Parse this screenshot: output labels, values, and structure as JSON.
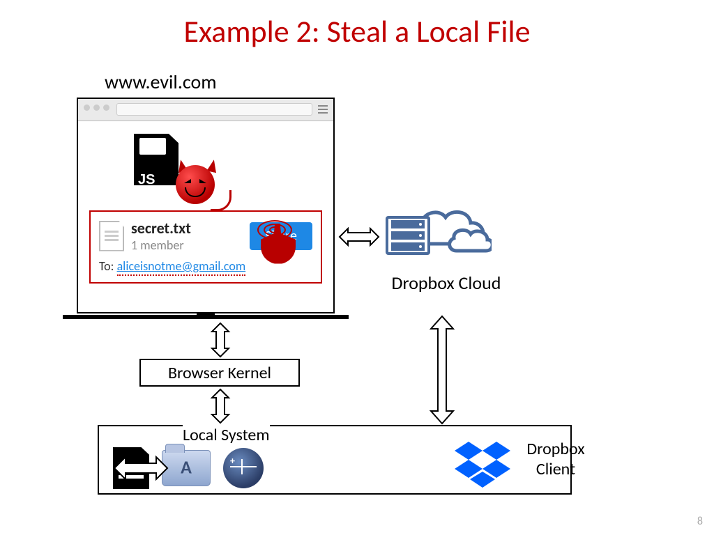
{
  "title": "Example 2: Steal a Local File",
  "url_label": "www.evil.com",
  "js_label": "JS",
  "share": {
    "filename": "secret.txt",
    "members": "1 member",
    "button": "Share",
    "to_label": "To:",
    "email": "aliceisnotme@gmail.com"
  },
  "labels": {
    "dropbox_cloud": "Dropbox Cloud",
    "browser_kernel": "Browser Kernel",
    "local_system": "Local System",
    "dropbox_client": "Dropbox Client"
  },
  "page_number": "8",
  "colors": {
    "title": "#c00000",
    "accent_blue": "#1e88e5",
    "cloud_blue": "#4a6b9c",
    "dropbox_blue": "#0061ff"
  }
}
